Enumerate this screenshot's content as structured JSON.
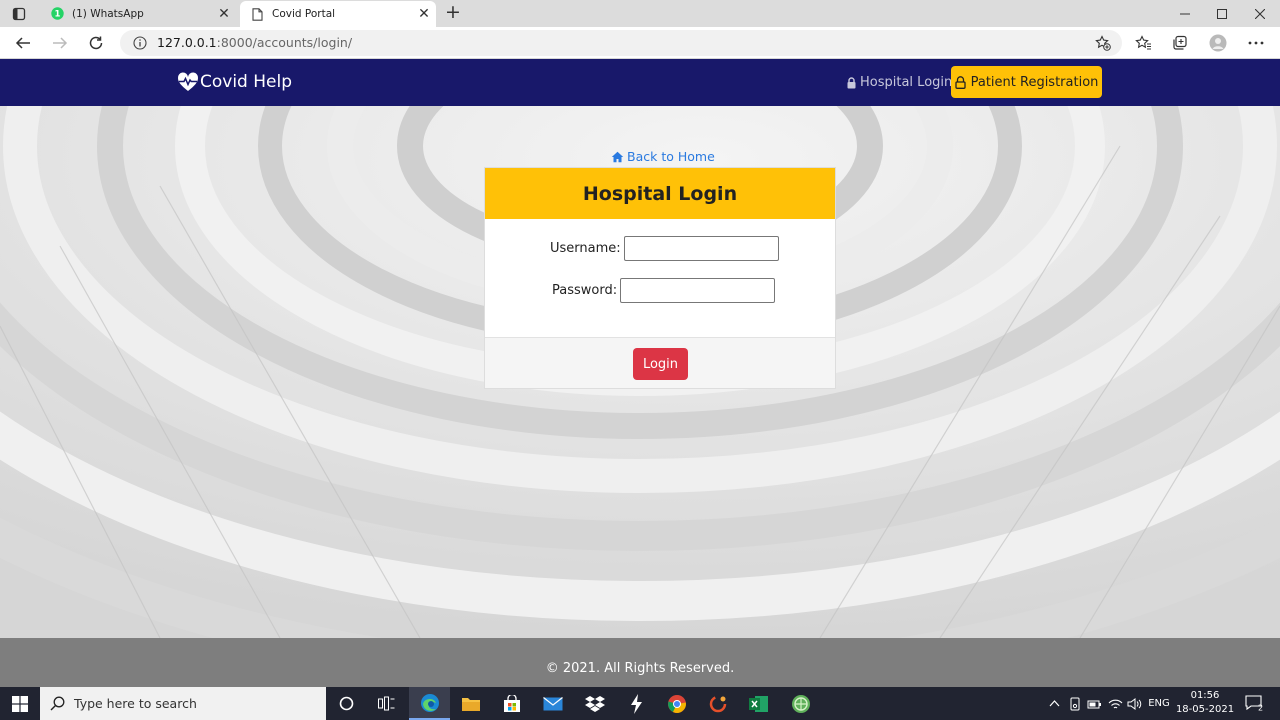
{
  "browser": {
    "tabs": [
      {
        "title": "(1) WhatsApp",
        "active": false,
        "badge": "1"
      },
      {
        "title": "Covid Portal",
        "active": true
      }
    ],
    "address": {
      "host": "127.0.0.1",
      "path": ":8000/accounts/login/"
    }
  },
  "navbar": {
    "brand": "Covid Help",
    "hospital_login": "Hospital Login",
    "patient_registration": "Patient Registration",
    "bg_color": "#18186a",
    "accent_color": "#ffc107"
  },
  "login": {
    "back_home": "Back to Home",
    "title": "Hospital Login",
    "username_label": "Username:",
    "username_value": "",
    "password_label": "Password:",
    "password_value": "",
    "submit": "Login",
    "submit_color": "#dc3545"
  },
  "footer": {
    "text": "© 2021. All Rights Reserved."
  },
  "taskbar": {
    "search_placeholder": "Type here to search",
    "apps": [
      "cortana-icon",
      "task-view-icon",
      "edge-icon",
      "file-explorer-icon",
      "store-icon",
      "mail-icon",
      "dropbox-icon",
      "bolt-app-icon",
      "chrome-icon",
      "media-app-icon",
      "excel-icon",
      "game-app-icon"
    ],
    "tray": {
      "language": "ENG",
      "time": "01:56",
      "date": "18-05-2021",
      "notifications": "2"
    }
  }
}
